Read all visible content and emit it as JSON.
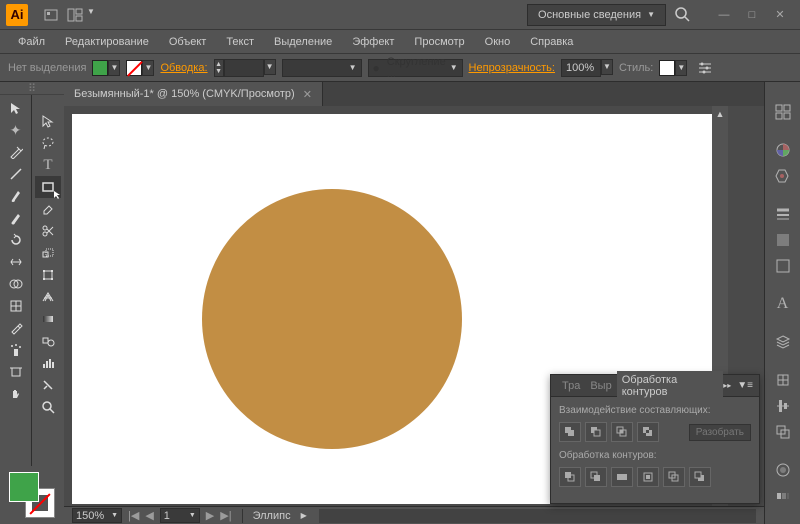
{
  "title": {
    "workspace": "Основные сведения"
  },
  "menu": [
    "Файл",
    "Редактирование",
    "Объект",
    "Текст",
    "Выделение",
    "Эффект",
    "Просмотр",
    "Окно",
    "Справка"
  ],
  "controlbar": {
    "selection": "Нет выделения",
    "fill_color": "#3fa349",
    "stroke_label": "Обводка:",
    "stroke_value": "",
    "brush_option": "Скругление ...",
    "opacity_label": "Непрозрачность:",
    "opacity_value": "100%",
    "style_label": "Стиль:",
    "style_color": "#ffffff"
  },
  "document": {
    "tab": "Безымянный-1* @ 150% (CMYK/Просмотр)"
  },
  "statusbar": {
    "zoom": "150%",
    "page": "1",
    "tool": "Эллипс"
  },
  "pathfinder": {
    "tabs": [
      "Тра",
      "Выр",
      "Обработка контуров"
    ],
    "active_tab": 2,
    "section1": "Взаимодействие составляющих:",
    "expand_btn": "Разобрать",
    "section2": "Обработка контуров:"
  },
  "artwork": {
    "shape": "ellipse",
    "fill": "#c28e44"
  },
  "chart_data": null
}
